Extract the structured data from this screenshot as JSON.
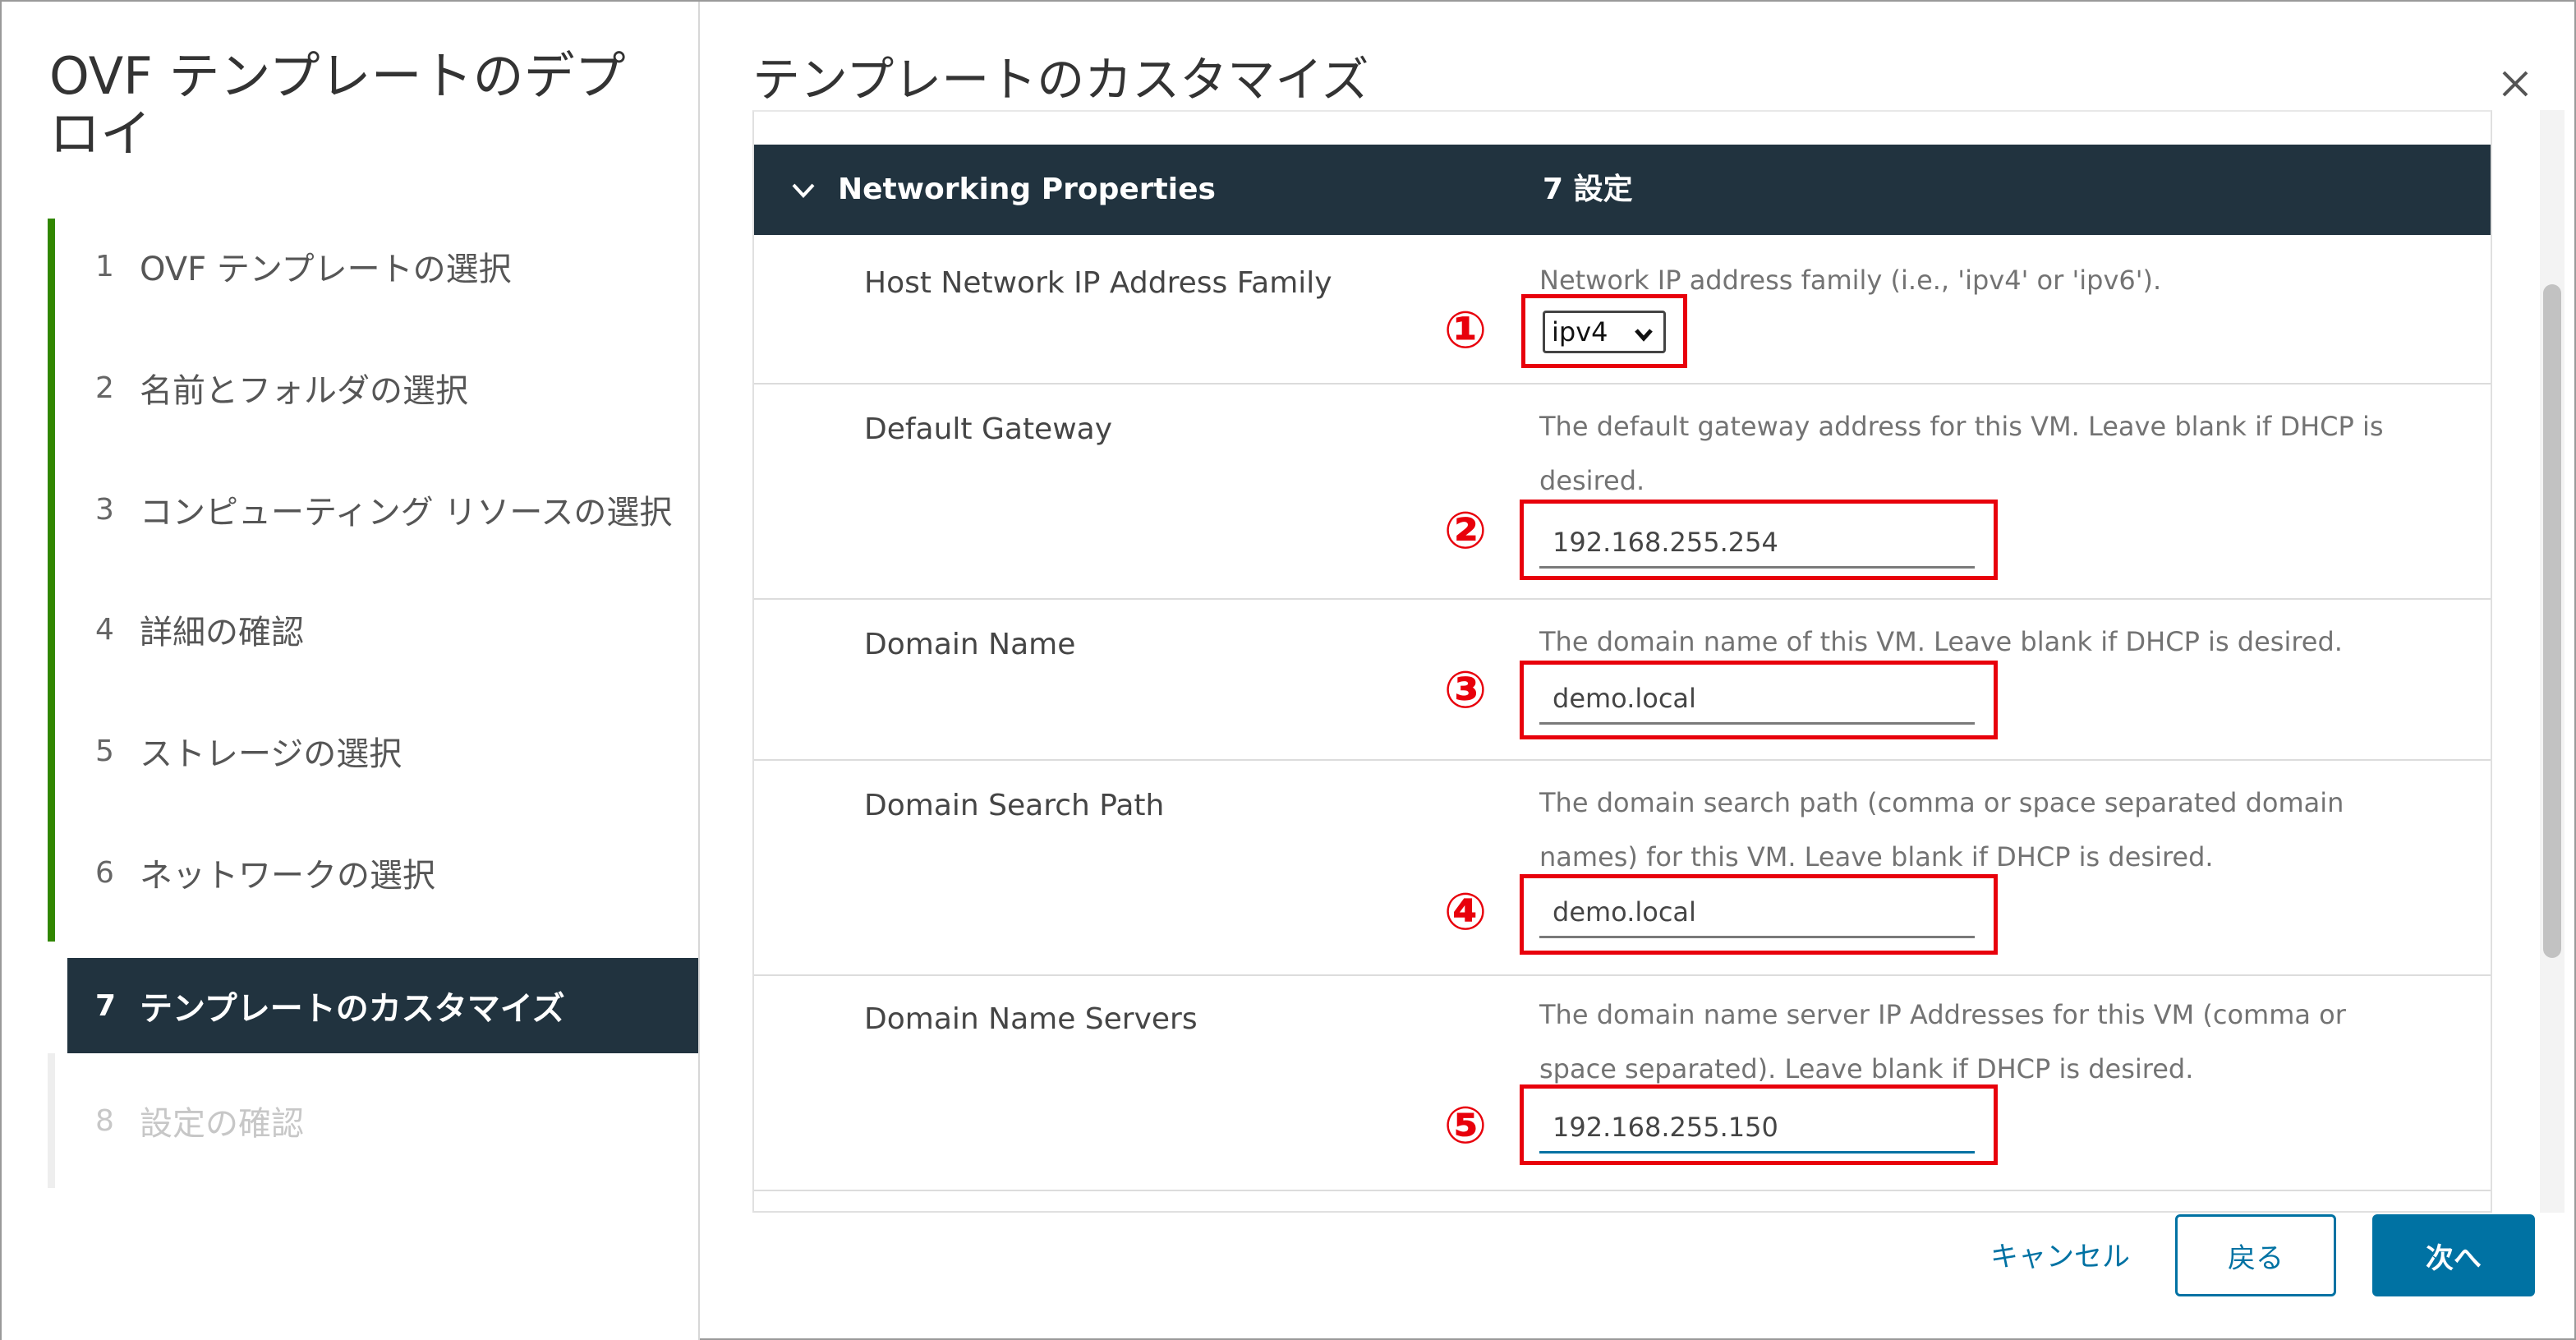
{
  "wizard": {
    "title": "OVF テンプレートのデプロイ",
    "steps": [
      {
        "num": "1",
        "label": "OVF テンプレートの選択",
        "state": "done"
      },
      {
        "num": "2",
        "label": "名前とフォルダの選択",
        "state": "done"
      },
      {
        "num": "3",
        "label": "コンピューティング リソースの選択",
        "state": "done"
      },
      {
        "num": "4",
        "label": "詳細の確認",
        "state": "done"
      },
      {
        "num": "5",
        "label": "ストレージの選択",
        "state": "done"
      },
      {
        "num": "6",
        "label": "ネットワークの選択",
        "state": "done"
      },
      {
        "num": "7",
        "label": "テンプレートのカスタマイズ",
        "state": "active"
      },
      {
        "num": "8",
        "label": "設定の確認",
        "state": "disabled"
      }
    ]
  },
  "page": {
    "title": "テンプレートのカスタマイズ",
    "close_icon": "close-icon"
  },
  "section": {
    "title": "Networking Properties",
    "count": "7 設定",
    "icon": "chevron-down-icon"
  },
  "properties": [
    {
      "label": "Host Network IP Address Family",
      "description": "Network IP address family (i.e., 'ipv4' or 'ipv6').",
      "value": "ipv4",
      "kind": "select",
      "annotation": "①"
    },
    {
      "label": "Default Gateway",
      "description_1": "The default gateway address for this VM. Leave blank if DHCP is",
      "description_2": "desired.",
      "value": "192.168.255.254",
      "kind": "text",
      "annotation": "②"
    },
    {
      "label": "Domain Name",
      "description": "The domain name of this VM. Leave blank if DHCP is desired.",
      "value": "demo.local",
      "kind": "text",
      "annotation": "③"
    },
    {
      "label": "Domain Search Path",
      "description_1": "The domain search path (comma or space separated domain",
      "description_2": "names) for this VM. Leave blank if DHCP is desired.",
      "value": "demo.local",
      "kind": "text",
      "annotation": "④"
    },
    {
      "label": "Domain Name Servers",
      "description_1": "The domain name server IP Addresses for this VM (comma or",
      "description_2": "space separated). Leave blank if DHCP is desired.",
      "value": "192.168.255.150",
      "kind": "text",
      "annotation": "⑤"
    }
  ],
  "footer": {
    "cancel": "キャンセル",
    "back": "戻る",
    "next": "次へ"
  },
  "colors": {
    "accent": "#0072a3",
    "header_bg": "#21333f",
    "annotation": "#e8000b",
    "progress": "#318700"
  }
}
